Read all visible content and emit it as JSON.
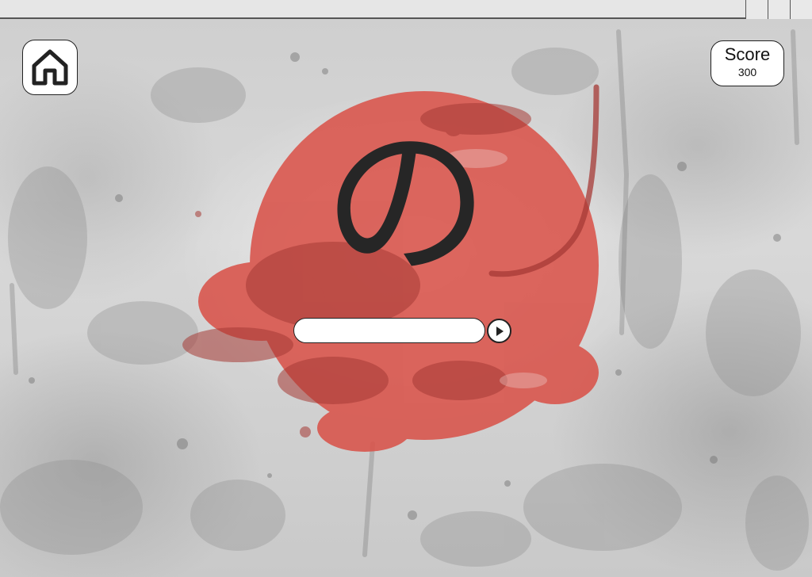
{
  "game": {
    "kana_character": "の",
    "answer_value": "",
    "answer_placeholder": ""
  },
  "score": {
    "label": "Score",
    "value": "300"
  },
  "icons": {
    "home": "home-icon",
    "submit": "play-icon"
  },
  "colors": {
    "sun_red": "#d9534a",
    "ink": "#262626",
    "background_gray": "#d3d3d3"
  }
}
